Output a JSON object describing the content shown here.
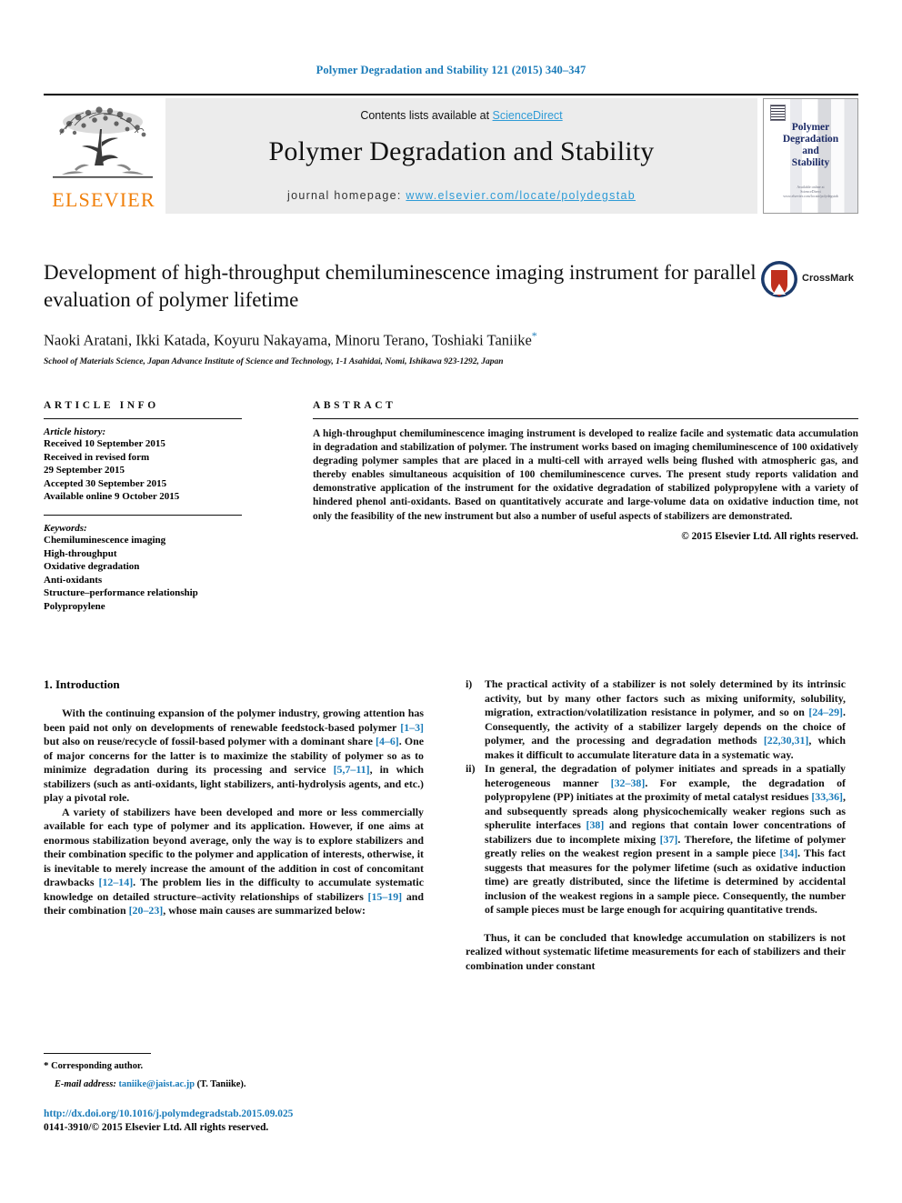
{
  "running_head": "Polymer Degradation and Stability 121 (2015) 340–347",
  "colors": {
    "link_blue": "#1a7bb9",
    "sciencedirect_blue": "#2e9bd6",
    "elsevier_orange": "#f07f09",
    "cover_navy": "#1b2a66",
    "crossmark_red": "#c02f1d",
    "crossmark_blue": "#1b3a6b"
  },
  "masthead": {
    "publisher_name": "ELSEVIER",
    "contents_prefix": "Contents lists available at ",
    "contents_link": "ScienceDirect",
    "journal_title": "Polymer Degradation and Stability",
    "homepage_prefix": "journal homepage: ",
    "homepage_url": "www.elsevier.com/locate/polydegstab",
    "cover": {
      "title_lines": [
        "Polymer",
        "Degradation",
        "and",
        "Stability"
      ],
      "foot_lines": [
        "Available online at",
        "ScienceDirect",
        "www.elsevier.com/locate/polydegstab"
      ]
    }
  },
  "article": {
    "title": "Development of high-throughput chemiluminescence imaging instrument for parallel evaluation of polymer lifetime",
    "authors": "Naoki Aratani, Ikki Katada, Koyuru Nakayama, Minoru Terano, Toshiaki Taniike",
    "corresponding_marker": "*",
    "affiliation": "School of Materials Science, Japan Advance Institute of Science and Technology, 1-1 Asahidai, Nomi, Ishikawa 923-1292, Japan",
    "crossmark_label": "CrossMark"
  },
  "article_info": {
    "heading": "ARTICLE INFO",
    "history_label": "Article history:",
    "history": [
      "Received 10 September 2015",
      "Received in revised form",
      "29 September 2015",
      "Accepted 30 September 2015",
      "Available online 9 October 2015"
    ],
    "keywords_label": "Keywords:",
    "keywords": [
      "Chemiluminescence imaging",
      "High-throughput",
      "Oxidative degradation",
      "Anti-oxidants",
      "Structure–performance relationship",
      "Polypropylene"
    ]
  },
  "abstract": {
    "heading": "ABSTRACT",
    "body": "A high-throughput chemiluminescence imaging instrument is developed to realize facile and systematic data accumulation in degradation and stabilization of polymer. The instrument works based on imaging chemiluminescence of 100 oxidatively degrading polymer samples that are placed in a multi-cell with arrayed wells being flushed with atmospheric gas, and thereby enables simultaneous acquisition of 100 chemiluminescence curves. The present study reports validation and demonstrative application of the instrument for the oxidative degradation of stabilized polypropylene with a variety of hindered phenol anti-oxidants. Based on quantitatively accurate and large-volume data on oxidative induction time, not only the feasibility of the new instrument but also a number of useful aspects of stabilizers are demonstrated.",
    "copyright": "© 2015 Elsevier Ltd. All rights reserved."
  },
  "body": {
    "section_number_title": "1. Introduction",
    "left_paragraphs": [
      {
        "segments": [
          {
            "t": "With the continuing expansion of the polymer industry, growing attention has been paid not only on developments of renewable feedstock-based polymer ",
            "ref": false
          },
          {
            "t": "[1–3]",
            "ref": true
          },
          {
            "t": " but also on reuse/recycle of fossil-based polymer with a dominant share ",
            "ref": false
          },
          {
            "t": "[4–6]",
            "ref": true
          },
          {
            "t": ". One of major concerns for the latter is to maximize the stability of polymer so as to minimize degradation during its processing and service ",
            "ref": false
          },
          {
            "t": "[5,7–11]",
            "ref": true
          },
          {
            "t": ", in which stabilizers (such as anti-oxidants, light stabilizers, anti-hydrolysis agents, and etc.) play a pivotal role.",
            "ref": false
          }
        ]
      },
      {
        "segments": [
          {
            "t": "A variety of stabilizers have been developed and more or less commercially available for each type of polymer and its application. However, if one aims at enormous stabilization beyond average, only the way is to explore stabilizers and their combination specific to the polymer and application of interests, otherwise, it is inevitable to merely increase the amount of the addition in cost of concomitant drawbacks ",
            "ref": false
          },
          {
            "t": "[12–14]",
            "ref": true
          },
          {
            "t": ". The problem lies in the difficulty to accumulate systematic knowledge on detailed structure–activity relationships of stabilizers ",
            "ref": false
          },
          {
            "t": "[15–19]",
            "ref": true
          },
          {
            "t": " and their combination ",
            "ref": false
          },
          {
            "t": "[20–23]",
            "ref": true
          },
          {
            "t": ", whose main causes are summarized below:",
            "ref": false
          }
        ]
      }
    ],
    "right_list": [
      {
        "marker": "i)",
        "segments": [
          {
            "t": "The practical activity of a stabilizer is not solely determined by its intrinsic activity, but by many other factors such as mixing uniformity, solubility, migration, extraction/volatilization resistance in polymer, and so on ",
            "ref": false
          },
          {
            "t": "[24–29]",
            "ref": true
          },
          {
            "t": ". Consequently, the activity of a stabilizer largely depends on the choice of polymer, and the processing and degradation methods ",
            "ref": false
          },
          {
            "t": "[22,30,31]",
            "ref": true
          },
          {
            "t": ", which makes it difficult to accumulate literature data in a systematic way.",
            "ref": false
          }
        ]
      },
      {
        "marker": "ii)",
        "segments": [
          {
            "t": "In general, the degradation of polymer initiates and spreads in a spatially heterogeneous manner ",
            "ref": false
          },
          {
            "t": "[32–38]",
            "ref": true
          },
          {
            "t": ". For example, the degradation of polypropylene (PP) initiates at the proximity of metal catalyst residues ",
            "ref": false
          },
          {
            "t": "[33,36]",
            "ref": true
          },
          {
            "t": ", and subsequently spreads along physicochemically weaker regions such as spherulite interfaces ",
            "ref": false
          },
          {
            "t": "[38]",
            "ref": true
          },
          {
            "t": " and regions that contain lower concentrations of stabilizers due to incomplete mixing ",
            "ref": false
          },
          {
            "t": "[37]",
            "ref": true
          },
          {
            "t": ". Therefore, the lifetime of polymer greatly relies on the weakest region present in a sample piece ",
            "ref": false
          },
          {
            "t": "[34]",
            "ref": true
          },
          {
            "t": ". This fact suggests that measures for the polymer lifetime (such as oxidative induction time) are greatly distributed, since the lifetime is determined by accidental inclusion of the weakest regions in a sample piece. Consequently, the number of sample pieces must be large enough for acquiring quantitative trends.",
            "ref": false
          }
        ]
      }
    ],
    "right_closing_paragraph": {
      "segments": [
        {
          "t": "Thus, it can be concluded that knowledge accumulation on stabilizers is not realized without systematic lifetime measurements for each of stabilizers and their combination under constant",
          "ref": false
        }
      ]
    }
  },
  "footnote": {
    "star": "*",
    "corresponding": "Corresponding author.",
    "email_label": "E-mail address:",
    "email": "taniike@jaist.ac.jp",
    "email_owner": "(T. Taniike)."
  },
  "footer": {
    "doi": "http://dx.doi.org/10.1016/j.polymdegradstab.2015.09.025",
    "issn_line": "0141-3910/© 2015 Elsevier Ltd. All rights reserved."
  }
}
